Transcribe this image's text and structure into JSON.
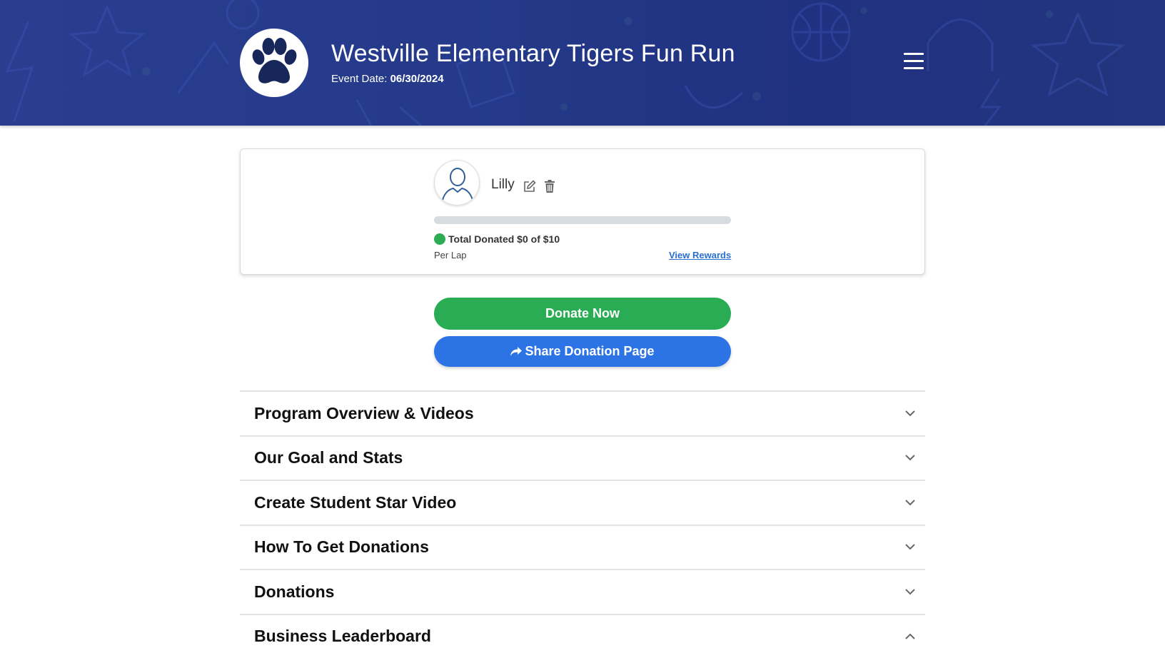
{
  "header": {
    "title": "Westville Elementary Tigers Fun Run",
    "event_date_label": "Event Date:",
    "event_date": "06/30/2024",
    "background_color": "#253a8a",
    "logo_icon": "paw-print-icon",
    "menu_icon": "hamburger-menu-icon"
  },
  "profile": {
    "name": "Lilly",
    "avatar_icon": "user-silhouette-icon",
    "edit_icon": "edit-icon",
    "delete_icon": "trash-icon",
    "progress_fraction": 0,
    "total_text": "Total Donated $0 of $10",
    "per_lap": "Per Lap",
    "view_rewards": "View Rewards",
    "status_color": "#2bac55"
  },
  "buttons": {
    "donate": "Donate Now",
    "share": "Share Donation Page",
    "share_icon": "share-arrow-icon",
    "donate_color": "#2aac55",
    "share_color": "#2c74e6"
  },
  "accordion": {
    "items": [
      {
        "label": "Program Overview & Videos",
        "expanded": false
      },
      {
        "label": "Our Goal and Stats",
        "expanded": false
      },
      {
        "label": "Create Student Star Video",
        "expanded": false
      },
      {
        "label": "How To Get Donations",
        "expanded": false
      },
      {
        "label": "Donations",
        "expanded": false
      },
      {
        "label": "Business Leaderboard",
        "expanded": true
      }
    ]
  }
}
